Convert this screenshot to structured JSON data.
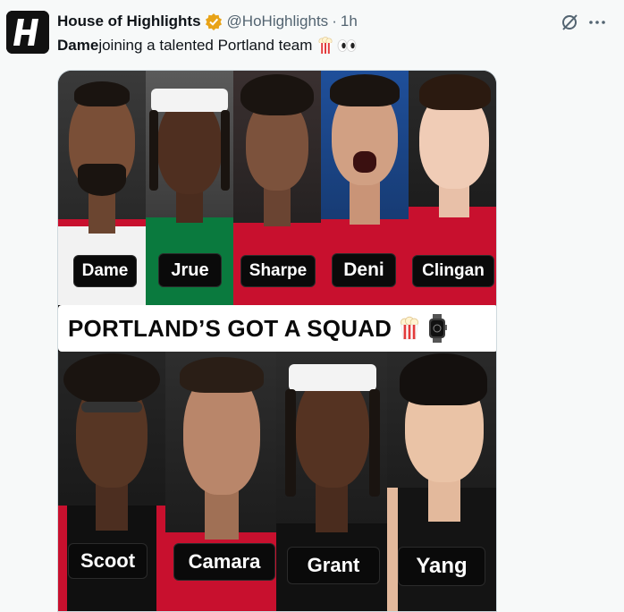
{
  "account": {
    "display_name": "House of Highlights",
    "handle": "@HoHighlights",
    "separator": "·",
    "time": "1h",
    "avatar_letter": "H",
    "verified_color": "#e8a317"
  },
  "tweet": {
    "mention": "Dame",
    "text": " joining a talented Portland team"
  },
  "media": {
    "banner": "PORTLAND’S GOT A SQUAD",
    "top_row": [
      {
        "name": "Dame"
      },
      {
        "name": "Jrue"
      },
      {
        "name": "Sharpe"
      },
      {
        "name": "Deni"
      },
      {
        "name": "Clingan"
      }
    ],
    "bottom_row": [
      {
        "name": "Scoot"
      },
      {
        "name": "Camara"
      },
      {
        "name": "Grant"
      },
      {
        "name": "Yang"
      }
    ]
  },
  "colors": {
    "blazers_red": "#c8102e",
    "celtics_green": "#0a7a3e",
    "muted_text": "#536471"
  },
  "icons": {
    "grok": "grok-icon",
    "more": "more-options-icon",
    "popcorn": "popcorn-icon",
    "eyes": "eyes-icon",
    "watch": "watch-icon"
  }
}
